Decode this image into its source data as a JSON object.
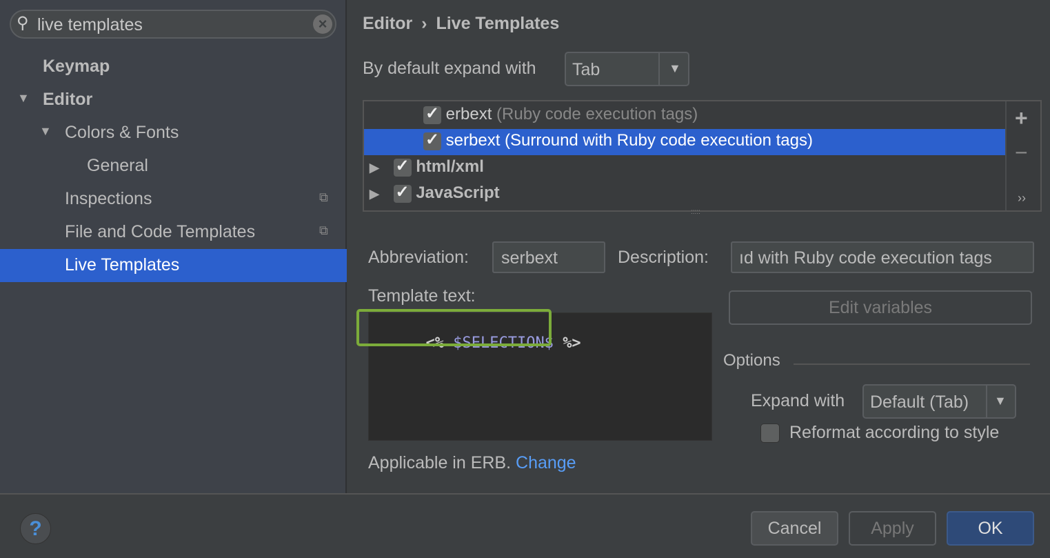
{
  "search": {
    "value": "live templates",
    "icon": "search-icon",
    "clear_icon": "clear-icon"
  },
  "sidebar": {
    "items": [
      {
        "label": "Keymap"
      },
      {
        "label": "Editor"
      },
      {
        "label": "Colors & Fonts"
      },
      {
        "label": "General"
      },
      {
        "label": "Inspections"
      },
      {
        "label": "File and Code Templates"
      },
      {
        "label": "Live Templates"
      }
    ]
  },
  "breadcrumb": {
    "parent": "Editor",
    "sep": "›",
    "current": "Live Templates"
  },
  "expand_default": {
    "label": "By default expand with",
    "value": "Tab"
  },
  "templates": [
    {
      "abbr": "erbext",
      "desc": "(Ruby code execution tags)",
      "checked": true
    },
    {
      "abbr": "serbext",
      "desc": "(Surround with Ruby code execution tags)",
      "checked": true,
      "selected": true
    },
    {
      "group": "html/xml",
      "checked": true
    },
    {
      "group": "JavaScript",
      "checked": true
    }
  ],
  "list_toolbar": {
    "add": "+",
    "remove": "−",
    "more": "››"
  },
  "abbreviation": {
    "label": "Abbreviation:",
    "value": "serbext"
  },
  "description": {
    "label": "Description:",
    "value": "ıd with Ruby code execution tags"
  },
  "template_text": {
    "label": "Template text:",
    "open": "<%",
    "var": "$SELECTION$",
    "close": "%>"
  },
  "edit_variables": "Edit variables",
  "options": {
    "title": "Options",
    "expand_label": "Expand with",
    "expand_value": "Default (Tab)",
    "reformat_label": "Reformat according to style",
    "reformat_checked": false
  },
  "applicable": {
    "text": "Applicable in ERB.",
    "link": "Change"
  },
  "footer": {
    "help": "?",
    "cancel": "Cancel",
    "apply": "Apply",
    "ok": "OK"
  },
  "colors": {
    "selection": "#2c60cd",
    "highlight": "#7cac3a",
    "link": "#589df6"
  }
}
